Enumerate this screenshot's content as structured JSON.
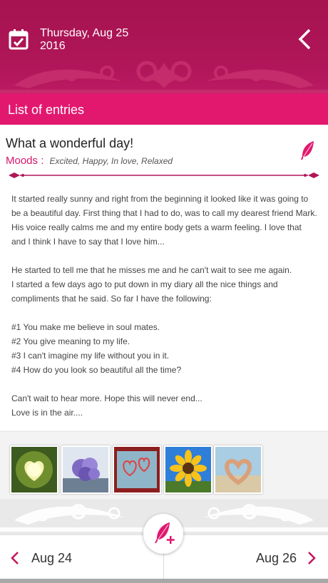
{
  "header": {
    "date_line1": "Thursday, Aug 25",
    "date_line2": "2016",
    "calendar_icon": "calendar-check-icon",
    "back_icon": "chevron-left-icon",
    "color": "#a5134f"
  },
  "section": {
    "title": "List of entries",
    "color": "#e2186f"
  },
  "entry": {
    "title": "What a wonderful day!",
    "moods_label": "Moods",
    "moods_separator": ":",
    "moods": "Excited, Happy, In love, Relaxed",
    "edit_icon": "feather-icon",
    "paragraphs": [
      "It started really sunny and right from the beginning it looked like it was going to be a beautiful day. First thing that I had to do, was to call my dearest friend Mark. His voice really calms me and my entire body gets a warm feeling. I love that and I think I have to say that I love him...",
      "He started to tell me that he misses me and he can't wait to see me again.",
      "I started a few days ago to put down in my diary all the nice things and compliments that he said. So far I have the following:",
      "#1 You make me believe in soul mates.",
      "#2 You give meaning to my life.",
      "#3 I can't imagine my life without you in it.",
      "#4 How do you look so beautiful all the time?",
      "Can't wait to hear more. Hope this will never end...",
      "Love is in the air...."
    ]
  },
  "photos": [
    {
      "name": "glowing-heart-photo"
    },
    {
      "name": "lilac-flowers-photo"
    },
    {
      "name": "hearts-on-window-photo"
    },
    {
      "name": "sunflower-photo"
    },
    {
      "name": "heart-hands-photo"
    }
  ],
  "fab": {
    "icon": "feather-plus-icon"
  },
  "nav": {
    "prev_label": "Aug 24",
    "next_label": "Aug 26",
    "accent": "#c2155e"
  }
}
